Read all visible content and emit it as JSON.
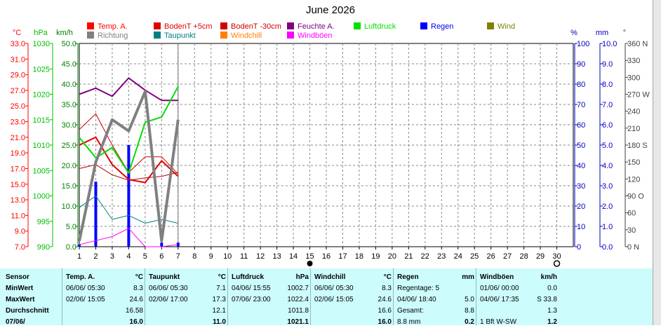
{
  "title": "June 2026",
  "legend": [
    {
      "label": "Temp. A.",
      "color": "#ff0000"
    },
    {
      "label": "BodenT +5cm",
      "color": "#e00000"
    },
    {
      "label": "BodenT -30cm",
      "color": "#d00000"
    },
    {
      "label": "Feuchte A.",
      "color": "#800080"
    },
    {
      "label": "Luftdruck",
      "color": "#00e000"
    },
    {
      "label": "Regen",
      "color": "#0000ff"
    },
    {
      "label": "Wind",
      "color": "#808000"
    },
    {
      "label": "Richtung",
      "color": "#808080"
    },
    {
      "label": "Taupunkt",
      "color": "#008080"
    },
    {
      "label": "Windchill",
      "color": "#ff8000"
    },
    {
      "label": "Windböen",
      "color": "#ff00ff"
    }
  ],
  "units": {
    "temp": "°C",
    "hpa": "hPa",
    "kmh": "km/h",
    "pct": "%",
    "mm": "mm",
    "deg": "°"
  },
  "chart_data": {
    "type": "line",
    "x": [
      1,
      2,
      3,
      4,
      5,
      6,
      7
    ],
    "xlim": [
      1,
      30
    ],
    "x_ticks": [
      1,
      2,
      3,
      4,
      5,
      6,
      7,
      8,
      9,
      10,
      11,
      12,
      13,
      14,
      15,
      16,
      17,
      18,
      19,
      20,
      21,
      22,
      23,
      24,
      25,
      26,
      27,
      28,
      29,
      30
    ],
    "axes": {
      "temp": {
        "label": "°C",
        "range": [
          7.0,
          33.0
        ],
        "ticks": [
          "33.0",
          "31.0",
          "29.0",
          "27.0",
          "25.0",
          "23.0",
          "21.0",
          "19.0",
          "17.0",
          "15.0",
          "13.0",
          "11.0",
          "9.0",
          "7.0"
        ],
        "color": "#ff0000"
      },
      "hpa": {
        "label": "hPa",
        "range": [
          990,
          1030
        ],
        "ticks": [
          "1030",
          "1025",
          "1020",
          "1015",
          "1010",
          "1005",
          "1000",
          "995",
          "990"
        ],
        "color": "#00c000"
      },
      "kmh": {
        "label": "km/h",
        "range": [
          0,
          50
        ],
        "ticks": [
          "50.0",
          "45.0",
          "40.0",
          "35.0",
          "30.0",
          "25.0",
          "20.0",
          "15.0",
          "10.0",
          "5.0",
          "0.0"
        ],
        "color": "#008000"
      },
      "pct": {
        "label": "%",
        "range": [
          0,
          100
        ],
        "ticks": [
          "100",
          "90",
          "80",
          "70",
          "60",
          "50",
          "40",
          "30",
          "20",
          "10",
          "0"
        ],
        "color": "#0000c0"
      },
      "mm": {
        "label": "mm",
        "range": [
          0,
          10
        ],
        "ticks": [
          "10.0",
          "9.0",
          "8.0",
          "7.0",
          "6.0",
          "5.0",
          "4.0",
          "3.0",
          "2.0",
          "1.0",
          "0.0"
        ],
        "color": "#0000c0"
      },
      "deg": {
        "label": "°",
        "range": [
          0,
          360
        ],
        "ticks": [
          "360 N",
          "330",
          "300",
          "270 W",
          "240",
          "210",
          "180 S",
          "150",
          "120",
          "90 O",
          "60",
          "30",
          "0 N"
        ],
        "color": "#404040"
      }
    },
    "series": [
      {
        "name": "Temp. A.",
        "axis": "temp",
        "color": "#e00000",
        "width": 2,
        "values": [
          20.0,
          21.0,
          17.5,
          15.6,
          15.2,
          18.0,
          16.0
        ]
      },
      {
        "name": "BodenT +5cm",
        "axis": "temp",
        "color": "#d00000",
        "width": 1,
        "values": [
          22.0,
          24.0,
          20.0,
          16.5,
          18.5,
          18.5,
          16.3
        ]
      },
      {
        "name": "BodenT -30cm",
        "axis": "temp",
        "color": "#c00000",
        "width": 1,
        "values": [
          17.0,
          17.5,
          16.2,
          15.5,
          15.8,
          16.0,
          16.5
        ]
      },
      {
        "name": "Feuchte A.",
        "axis": "pct",
        "color": "#800080",
        "width": 2,
        "values": [
          75,
          78,
          74,
          83,
          77,
          72,
          72
        ]
      },
      {
        "name": "Luftdruck",
        "axis": "hpa",
        "color": "#00e000",
        "width": 2,
        "values": [
          1011.5,
          1007.5,
          1009.5,
          1004.5,
          1014.5,
          1015.5,
          1021.5
        ]
      },
      {
        "name": "Taupunkt",
        "axis": "temp",
        "color": "#008080",
        "width": 1,
        "values": [
          12.0,
          13.5,
          10.5,
          11.0,
          10.0,
          10.5,
          10.0
        ]
      },
      {
        "name": "Windböen",
        "axis": "kmh",
        "color": "#ff00ff",
        "width": 1,
        "values": [
          0.5,
          1.5,
          2.5,
          4.5,
          0,
          0,
          0.5
        ]
      },
      {
        "name": "Richtung",
        "axis": "deg",
        "color": "#808080",
        "width": 4,
        "values": [
          10,
          150,
          225,
          205,
          275,
          10,
          225
        ]
      }
    ],
    "bars": {
      "name": "Regen",
      "axis": "mm",
      "color": "#0000ff",
      "values": [
        0.1,
        3.2,
        0,
        5.0,
        0,
        0.2,
        0.2
      ]
    },
    "cursor_x": 7,
    "moon_phases": [
      {
        "x": 15,
        "phase": "full-moon-icon"
      },
      {
        "x": 30,
        "phase": "crescent-icon"
      }
    ]
  },
  "table": {
    "headers": [
      {
        "label": "Sensor",
        "unit": ""
      },
      {
        "label": "Temp. A.",
        "unit": "°C"
      },
      {
        "label": "Taupunkt",
        "unit": "°C"
      },
      {
        "label": "Luftdruck",
        "unit": "hPa"
      },
      {
        "label": "Windchill",
        "unit": "°C"
      },
      {
        "label": "Regen",
        "unit": "mm"
      },
      {
        "label": "Windböen",
        "unit": "km/h"
      }
    ],
    "rows": [
      {
        "label": "MinWert",
        "cells": [
          [
            "06/06/ 05:30",
            "8.3"
          ],
          [
            "06/06/ 05:30",
            "7.1"
          ],
          [
            "04/06/ 15:55",
            "1002.7"
          ],
          [
            "06/06/ 05:30",
            "8.3"
          ],
          [
            "Regentage: 5",
            ""
          ],
          [
            "01/06/ 00:00",
            "0.0"
          ]
        ]
      },
      {
        "label": "MaxWert",
        "cells": [
          [
            "02/06/ 15:05",
            "24.6"
          ],
          [
            "02/06/ 17:00",
            "17.3"
          ],
          [
            "07/06/ 23:00",
            "1022.4"
          ],
          [
            "02/06/ 15:05",
            "24.6"
          ],
          [
            "04/06/ 18:40",
            "5.0"
          ],
          [
            "04/06/ 17:35",
            "S 33.8"
          ]
        ]
      },
      {
        "label": "Durchschnitt",
        "cells": [
          [
            "",
            "16.58"
          ],
          [
            "",
            "12.1"
          ],
          [
            "",
            "1011.8"
          ],
          [
            "",
            "16.6"
          ],
          [
            "Gesamt:",
            "8.8"
          ],
          [
            "",
            "1.3"
          ]
        ]
      },
      {
        "label": "07/06/",
        "cells": [
          [
            "",
            "16.0"
          ],
          [
            "",
            "11.0"
          ],
          [
            "",
            "1021.1"
          ],
          [
            "",
            "16.0"
          ],
          [
            "8.8 mm",
            "0.2"
          ],
          [
            "1 Bft W-SW",
            "1.2"
          ]
        ]
      }
    ]
  }
}
